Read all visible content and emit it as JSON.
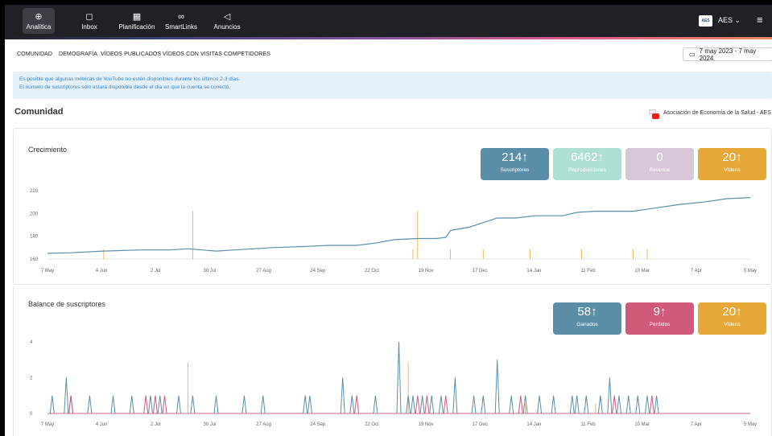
{
  "nav": [
    {
      "label": "Analítica",
      "icon": "search-chart-icon",
      "glyph": "⊕",
      "active": true
    },
    {
      "label": "Inbox",
      "icon": "chat-icon",
      "glyph": "◻",
      "active": false
    },
    {
      "label": "Planificación",
      "icon": "calendar-icon",
      "glyph": "▦",
      "active": false
    },
    {
      "label": "SmartLinks",
      "icon": "link-icon",
      "glyph": "∞",
      "active": false
    },
    {
      "label": "Anuncios",
      "icon": "megaphone-icon",
      "glyph": "◁",
      "active": false
    }
  ],
  "account": {
    "logo_text": "AES",
    "name": "AES ⌄"
  },
  "tabs": [
    "COMUNIDAD",
    "DEMOGRAFÍA",
    "VÍDEOS PUBLICADOS",
    "VÍDEOS CON VISITAS",
    "COMPETIDORES"
  ],
  "date_range": "7 may 2023 - 7 may 2024",
  "info": {
    "line1": "Es posible que algunas métricas de YouTube no estén disponibles durante los últimos 2-3 días.",
    "line2": "El número de suscriptores solo estará disponible desde el día en que la cuenta se conectó."
  },
  "section_title": "Comunidad",
  "channel": "Asociación de Economía de la Salud - AES",
  "growth": {
    "title": "Crecimiento",
    "cards": [
      {
        "value": "214↑",
        "label": "Suscriptores",
        "color": "#5b8fa8"
      },
      {
        "value": "6462↑",
        "label": "Reproducciones",
        "color": "#aedfd3"
      },
      {
        "value": "0",
        "label": "Revenue",
        "color": "#d9c6d9"
      },
      {
        "value": "20↑",
        "label": "Vídeos",
        "color": "#e8a838"
      }
    ]
  },
  "balance": {
    "title": "Balance de suscriptores",
    "cards": [
      {
        "value": "58↑",
        "label": "Ganados",
        "color": "#5b8fa8"
      },
      {
        "value": "9↑",
        "label": "Perdidos",
        "color": "#cf5b7b"
      },
      {
        "value": "20↑",
        "label": "Vídeos",
        "color": "#e8a838"
      }
    ]
  },
  "chart_data": [
    {
      "type": "line",
      "title": "Crecimiento",
      "x_ticks": [
        "7 May",
        "4 Jun",
        "2 Jul",
        "30 Jul",
        "27 Aug",
        "24 Sep",
        "22 Oct",
        "19 Nov",
        "17 Dec",
        "14 Jan",
        "11 Feb",
        "10 Mar",
        "7 Apr",
        "5 May"
      ],
      "y_ticks": [
        160,
        180,
        200,
        220
      ],
      "ylim": [
        160,
        225
      ],
      "series": [
        {
          "name": "Suscriptores",
          "color": "#5b8fa8",
          "points": [
            [
              0,
              165
            ],
            [
              0.05,
              165.5
            ],
            [
              0.12,
              167
            ],
            [
              0.2,
              168
            ],
            [
              0.26,
              168
            ],
            [
              0.3,
              169
            ],
            [
              0.33,
              168
            ],
            [
              0.36,
              167
            ],
            [
              0.4,
              168
            ],
            [
              0.48,
              170
            ],
            [
              0.55,
              171
            ],
            [
              0.6,
              172
            ],
            [
              0.66,
              172
            ],
            [
              0.7,
              174
            ],
            [
              0.74,
              177
            ],
            [
              0.79,
              178
            ],
            [
              0.83,
              178
            ],
            [
              0.85,
              179
            ],
            [
              0.86,
              185
            ],
            [
              0.9,
              188
            ],
            [
              0.93,
              192
            ],
            [
              0.96,
              196
            ],
            [
              1.0,
              196
            ],
            [
              1.04,
              198
            ],
            [
              1.1,
              198
            ],
            [
              1.13,
              201
            ],
            [
              1.17,
              202
            ],
            [
              1.25,
              202
            ],
            [
              1.3,
              205
            ],
            [
              1.35,
              208
            ],
            [
              1.4,
              210
            ],
            [
              1.45,
              213
            ],
            [
              1.5,
              214
            ]
          ]
        }
      ],
      "video_markers": [
        0.12,
        0.31,
        0.78,
        0.79,
        0.86,
        0.93,
        1.03,
        1.14,
        1.25,
        1.28
      ]
    },
    {
      "type": "line",
      "title": "Balance de suscriptores",
      "x_ticks": [
        "7 May",
        "4 Jun",
        "2 Jul",
        "30 Jul",
        "27 Aug",
        "24 Sep",
        "22 Oct",
        "19 Nov",
        "17 Dec",
        "14 Jan",
        "11 Feb",
        "10 Mar",
        "7 Apr",
        "5 May"
      ],
      "y_ticks": [
        0,
        2,
        4
      ],
      "ylim": [
        0,
        4.4
      ],
      "series": [
        {
          "name": "Ganados",
          "color": "#5b8fa8",
          "spikes": [
            [
              0.01,
              1
            ],
            [
              0.04,
              2
            ],
            [
              0.05,
              1
            ],
            [
              0.09,
              1
            ],
            [
              0.14,
              1
            ],
            [
              0.18,
              1
            ],
            [
              0.22,
              1
            ],
            [
              0.24,
              1
            ],
            [
              0.28,
              1
            ],
            [
              0.31,
              1
            ],
            [
              0.36,
              1
            ],
            [
              0.42,
              1
            ],
            [
              0.46,
              1
            ],
            [
              0.55,
              1
            ],
            [
              0.56,
              1
            ],
            [
              0.63,
              2
            ],
            [
              0.65,
              1
            ],
            [
              0.7,
              1
            ],
            [
              0.75,
              4
            ],
            [
              0.77,
              1
            ],
            [
              0.78,
              1
            ],
            [
              0.8,
              1
            ],
            [
              0.82,
              1
            ],
            [
              0.84,
              1
            ],
            [
              0.87,
              2
            ],
            [
              0.91,
              1
            ],
            [
              0.93,
              1
            ],
            [
              0.96,
              3
            ],
            [
              0.99,
              1
            ],
            [
              1.02,
              1
            ],
            [
              1.05,
              1
            ],
            [
              1.08,
              1
            ],
            [
              1.12,
              1
            ],
            [
              1.13,
              1
            ],
            [
              1.15,
              1
            ],
            [
              1.18,
              1
            ],
            [
              1.2,
              2
            ],
            [
              1.22,
              1
            ],
            [
              1.24,
              1
            ],
            [
              1.26,
              1
            ],
            [
              1.28,
              1
            ],
            [
              1.3,
              1
            ]
          ]
        },
        {
          "name": "Perdidos",
          "color": "#cf5b7b",
          "spikes": [
            [
              0.05,
              1
            ],
            [
              0.21,
              1
            ],
            [
              0.23,
              1
            ],
            [
              0.25,
              1
            ],
            [
              0.66,
              1
            ],
            [
              0.79,
              1
            ],
            [
              0.81,
              1
            ],
            [
              0.85,
              1
            ],
            [
              1.01,
              1
            ],
            [
              1.21,
              1
            ],
            [
              1.29,
              1
            ]
          ]
        }
      ],
      "video_markers": [
        0.3,
        0.77,
        1.02,
        1.17
      ]
    }
  ]
}
